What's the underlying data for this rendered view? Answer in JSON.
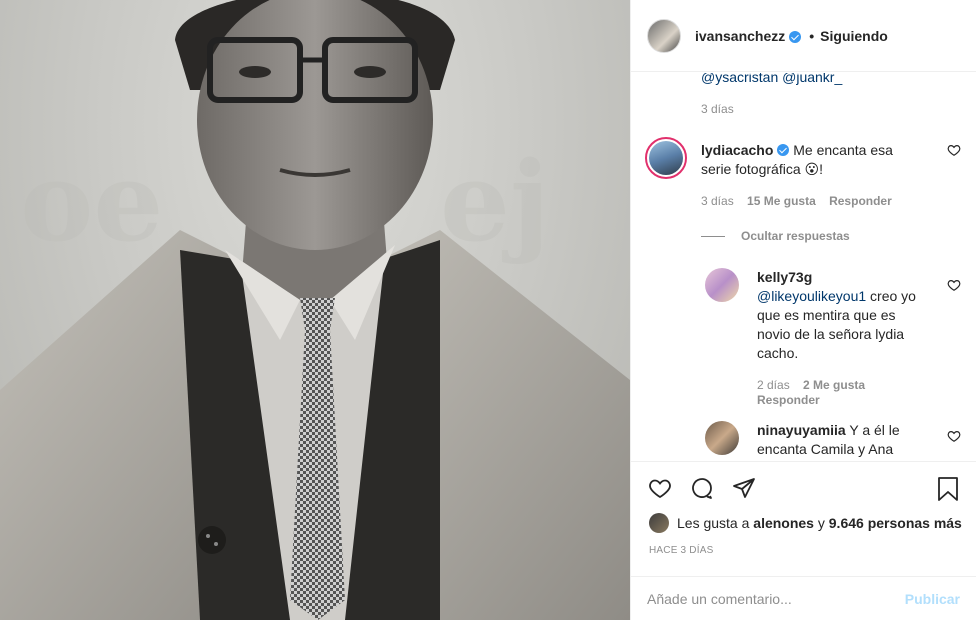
{
  "post": {
    "username": "ivansanchezz",
    "separator": "•",
    "follow_status": "Siguiendo"
  },
  "comments": {
    "previous": {
      "mentions": "@ysacristan @juankr_",
      "time": "3 días"
    },
    "lydia": {
      "username": "lydiacacho",
      "text": "Me encanta esa serie fotográfica",
      "emoji": "😮",
      "suffix": "!",
      "time": "3 días",
      "likes": "15 Me gusta",
      "reply": "Responder"
    },
    "hide_replies": "Ocultar respuestas",
    "kelly": {
      "username": "kelly73g",
      "mention": "@likeyoulikeyou1",
      "text": " creo yo que es mentira que es novio de la señora lydia cacho.",
      "time": "2 días",
      "likes": "2 Me gusta",
      "reply": "Responder"
    },
    "nina": {
      "username": "ninayuyamiia",
      "text": "Y a él le encanta Camila y Ana"
    }
  },
  "likes": {
    "prefix": "Les gusta a ",
    "user": "alenones",
    "middle": " y ",
    "count": "9.646 personas más"
  },
  "posted_ago": "HACE 3 DÍAS",
  "comment_input": {
    "placeholder": "Añade un comentario...",
    "submit": "Publicar"
  },
  "icons": [
    "heart-icon",
    "comment-icon",
    "share-icon",
    "bookmark-icon",
    "verified-badge-icon"
  ],
  "colors": {
    "link": "#00376b",
    "verified": "#3897f0",
    "muted": "#8e8e8e",
    "publish_disabled": "#b2dffc"
  }
}
